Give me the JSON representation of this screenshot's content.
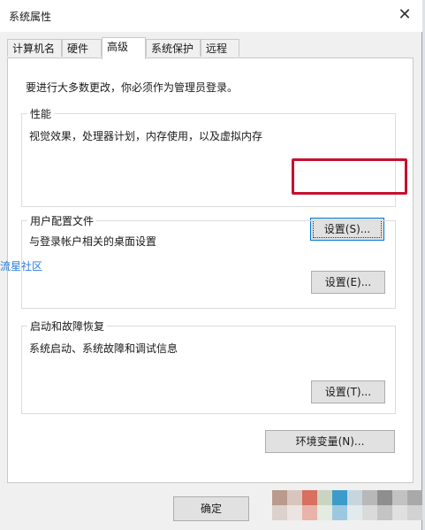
{
  "window": {
    "title": "系统属性",
    "close_glyph": "✕"
  },
  "tabs": [
    {
      "label": "计算机名",
      "active": false
    },
    {
      "label": "硬件",
      "active": false
    },
    {
      "label": "高级",
      "active": true
    },
    {
      "label": "系统保护",
      "active": false
    },
    {
      "label": "远程",
      "active": false
    }
  ],
  "panel": {
    "notice": "要进行大多数更改，你必须作为管理员登录。",
    "performance": {
      "title": "性能",
      "description": "视觉效果，处理器计划，内存使用，以及虚拟内存",
      "button": "设置(S)..."
    },
    "user_profiles": {
      "title": "用户配置文件",
      "description": "与登录帐户相关的桌面设置",
      "button": "设置(E)..."
    },
    "startup_recovery": {
      "title": "启动和故障恢复",
      "description": "系统启动、系统故障和调试信息",
      "button": "设置(T)..."
    },
    "env_button": "环境变量(N)..."
  },
  "footer": {
    "ok_button": "确定"
  },
  "watermark": "流星社区",
  "colors": {
    "highlight": "#c8102e",
    "focus": "#0078d7",
    "watermark": "#2a7ad8"
  }
}
